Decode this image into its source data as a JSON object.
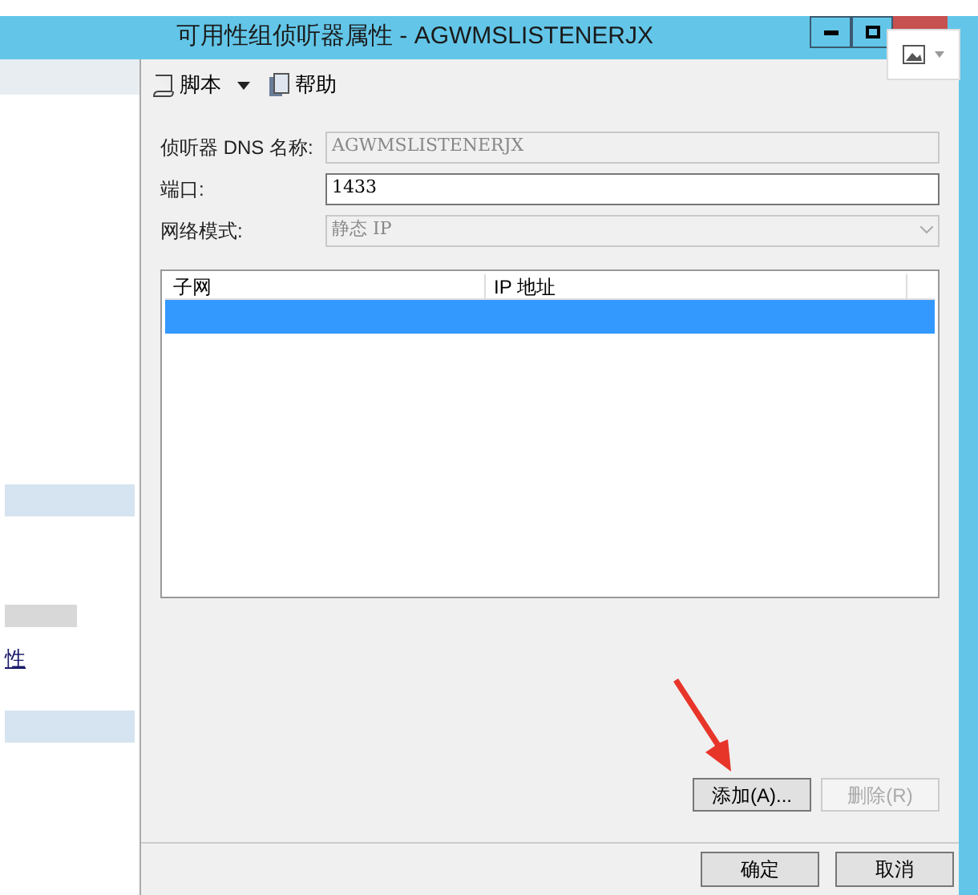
{
  "window": {
    "title": "可用性组侦听器属性 - AGWMSLISTENERJX"
  },
  "toolbar": [
    {
      "kind": "script",
      "label": "脚本"
    },
    {
      "kind": "help",
      "label": "帮助"
    }
  ],
  "sidebar": {
    "link": "性"
  },
  "form": [
    {
      "label": "侦听器 DNS 名称:",
      "value": "AGWMSLISTENERJX",
      "disabled": true,
      "kind": "text"
    },
    {
      "label": "端口:",
      "value": "1433",
      "disabled": false,
      "kind": "text"
    },
    {
      "label": "网络模式:",
      "value": "静态 IP",
      "disabled": true,
      "kind": "select"
    }
  ],
  "table": {
    "columns": [
      "子网",
      "IP 地址"
    ],
    "rows": [
      {
        "selected": true
      }
    ]
  },
  "list_buttons": [
    {
      "label": "添加(A)...",
      "disabled": false
    },
    {
      "label": "删除(R)",
      "disabled": true
    }
  ],
  "dialog_buttons": [
    {
      "label": "确定"
    },
    {
      "label": "取消"
    }
  ]
}
